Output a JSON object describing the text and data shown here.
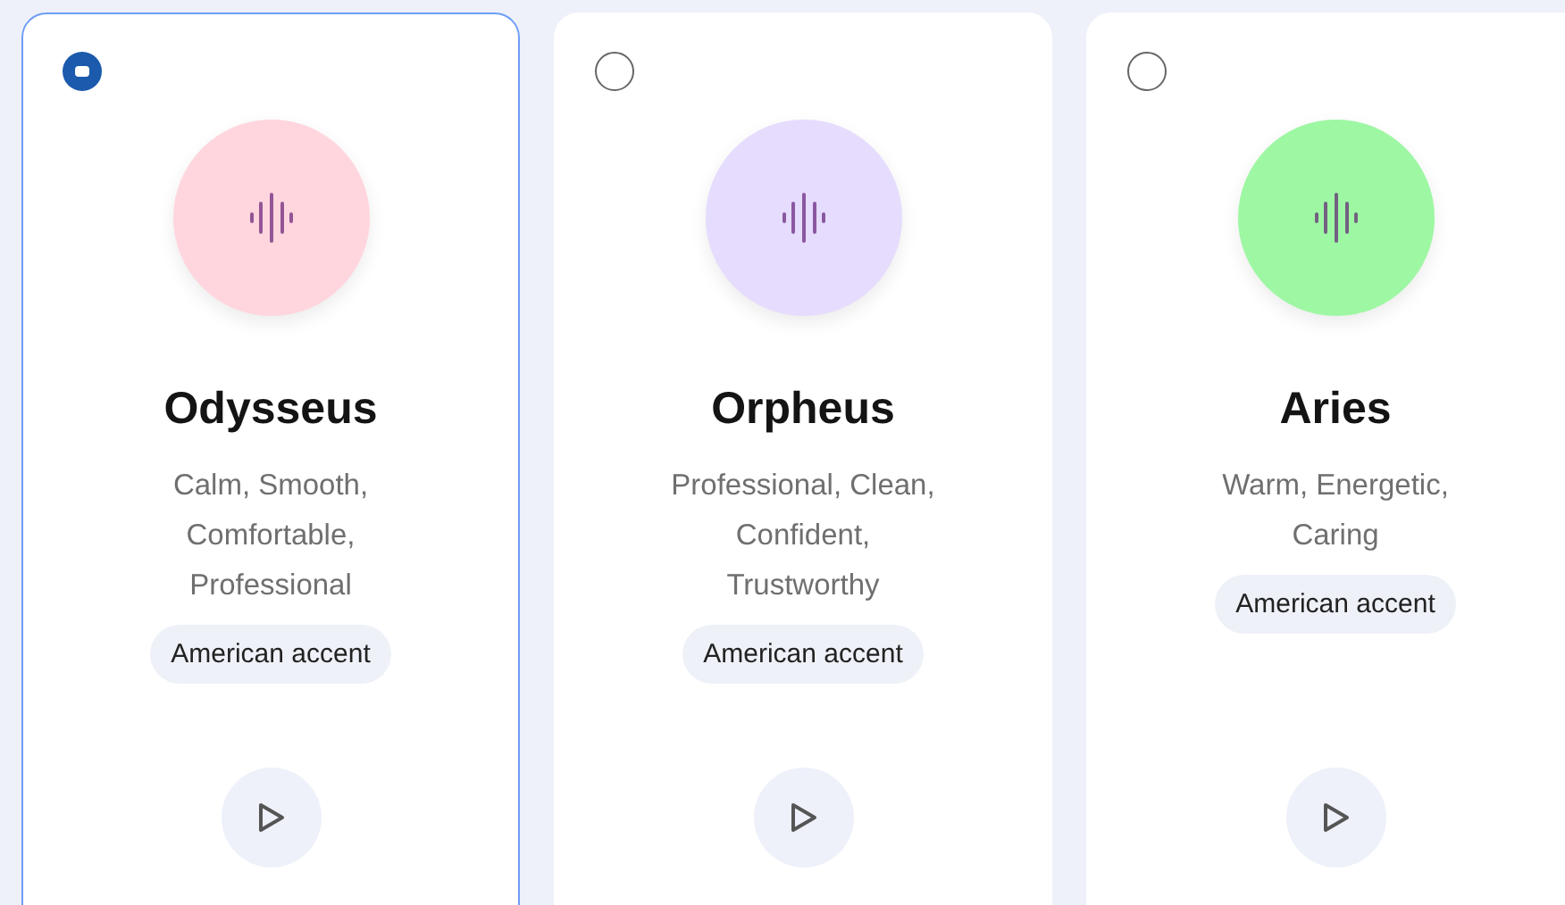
{
  "voices": [
    {
      "name": "Odysseus",
      "traits": "Calm, Smooth, Comfortable, Professional",
      "accent": "American accent",
      "selected": true,
      "color": "#ffd6de"
    },
    {
      "name": "Orpheus",
      "traits": "Professional, Clean, Confident, Trustworthy",
      "accent": "American accent",
      "selected": false,
      "color": "#e6dcfd"
    },
    {
      "name": "Aries",
      "traits": "Warm, Energetic, Caring",
      "accent": "American accent",
      "selected": false,
      "color": "#9ef7a3"
    }
  ]
}
